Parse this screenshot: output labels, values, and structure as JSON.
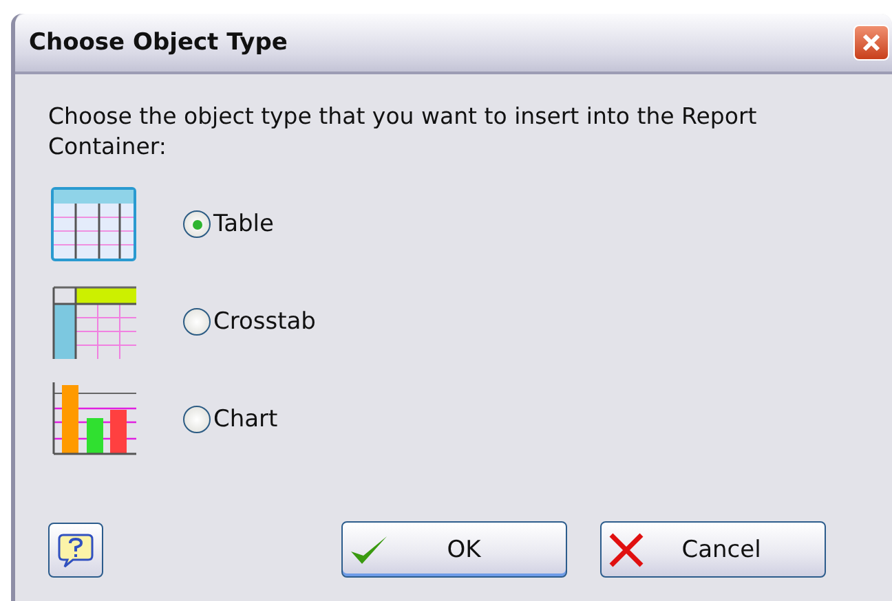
{
  "window": {
    "title": "Choose Object Type"
  },
  "prompt": "Choose the object type that you want to insert into the Report Container:",
  "options": [
    {
      "label": "Table",
      "kind": "table",
      "selected": true
    },
    {
      "label": "Crosstab",
      "kind": "crosstab",
      "selected": false
    },
    {
      "label": "Chart",
      "kind": "chart",
      "selected": false
    }
  ],
  "buttons": [
    {
      "label": "OK",
      "kind": "ok"
    },
    {
      "label": "Cancel",
      "kind": "cancel"
    }
  ]
}
